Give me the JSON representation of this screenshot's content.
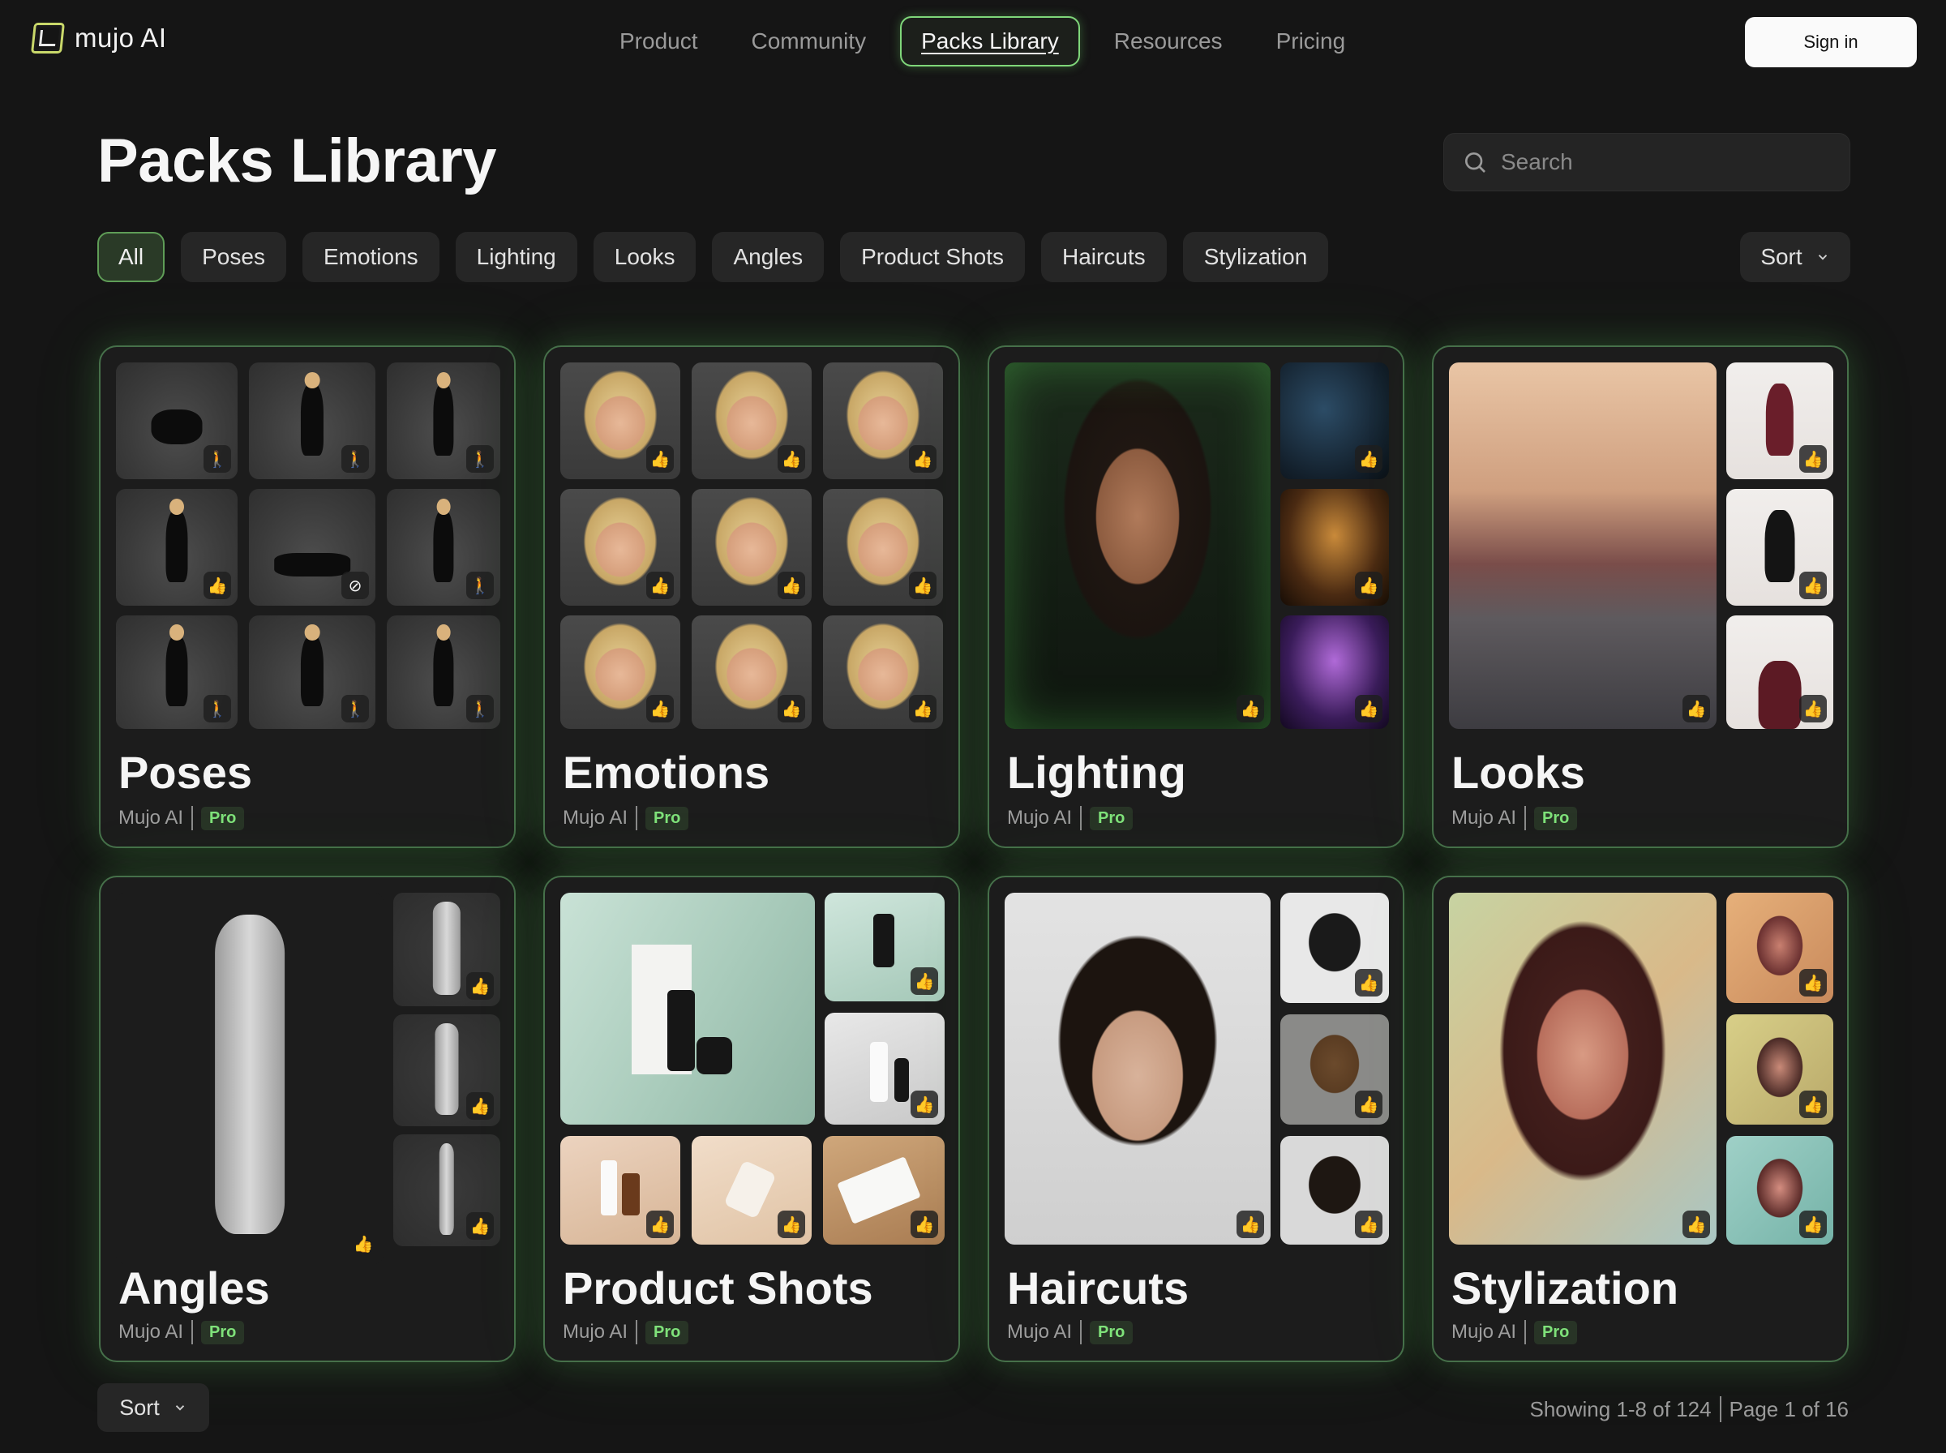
{
  "brand": {
    "name": "mujo AI"
  },
  "nav": {
    "items": [
      "Product",
      "Community",
      "Packs Library",
      "Resources",
      "Pricing"
    ],
    "active": "Packs Library"
  },
  "auth": {
    "sign_in_label": "Sign in"
  },
  "page": {
    "title": "Packs Library"
  },
  "search": {
    "placeholder": "Search",
    "value": ""
  },
  "filters": {
    "chips": [
      "All",
      "Poses",
      "Emotions",
      "Lighting",
      "Looks",
      "Angles",
      "Product Shots",
      "Haircuts",
      "Stylization"
    ],
    "active": "All",
    "sort_label": "Sort"
  },
  "packs": [
    {
      "title": "Poses",
      "author": "Mujo AI",
      "tier": "Pro"
    },
    {
      "title": "Emotions",
      "author": "Mujo AI",
      "tier": "Pro"
    },
    {
      "title": "Lighting",
      "author": "Mujo AI",
      "tier": "Pro"
    },
    {
      "title": "Looks",
      "author": "Mujo AI",
      "tier": "Pro"
    },
    {
      "title": "Angles",
      "author": "Mujo AI",
      "tier": "Pro"
    },
    {
      "title": "Product Shots",
      "author": "Mujo AI",
      "tier": "Pro"
    },
    {
      "title": "Haircuts",
      "author": "Mujo AI",
      "tier": "Pro"
    },
    {
      "title": "Stylization",
      "author": "Mujo AI",
      "tier": "Pro"
    }
  ],
  "icons": {
    "like": "thumbs-up-icon",
    "pose": "person-pose-icon",
    "hidden": "eye-off-icon",
    "search": "search-icon",
    "chevron": "chevron-down-icon"
  },
  "colors": {
    "accent": "#7fd67a",
    "pro_badge_text": "#7fe27a",
    "like_icon": "#f2c038",
    "background": "#151515"
  },
  "footer": {
    "sort_label": "Sort",
    "showing": "Showing 1-8 of 124",
    "page": "Page 1 of 16"
  }
}
